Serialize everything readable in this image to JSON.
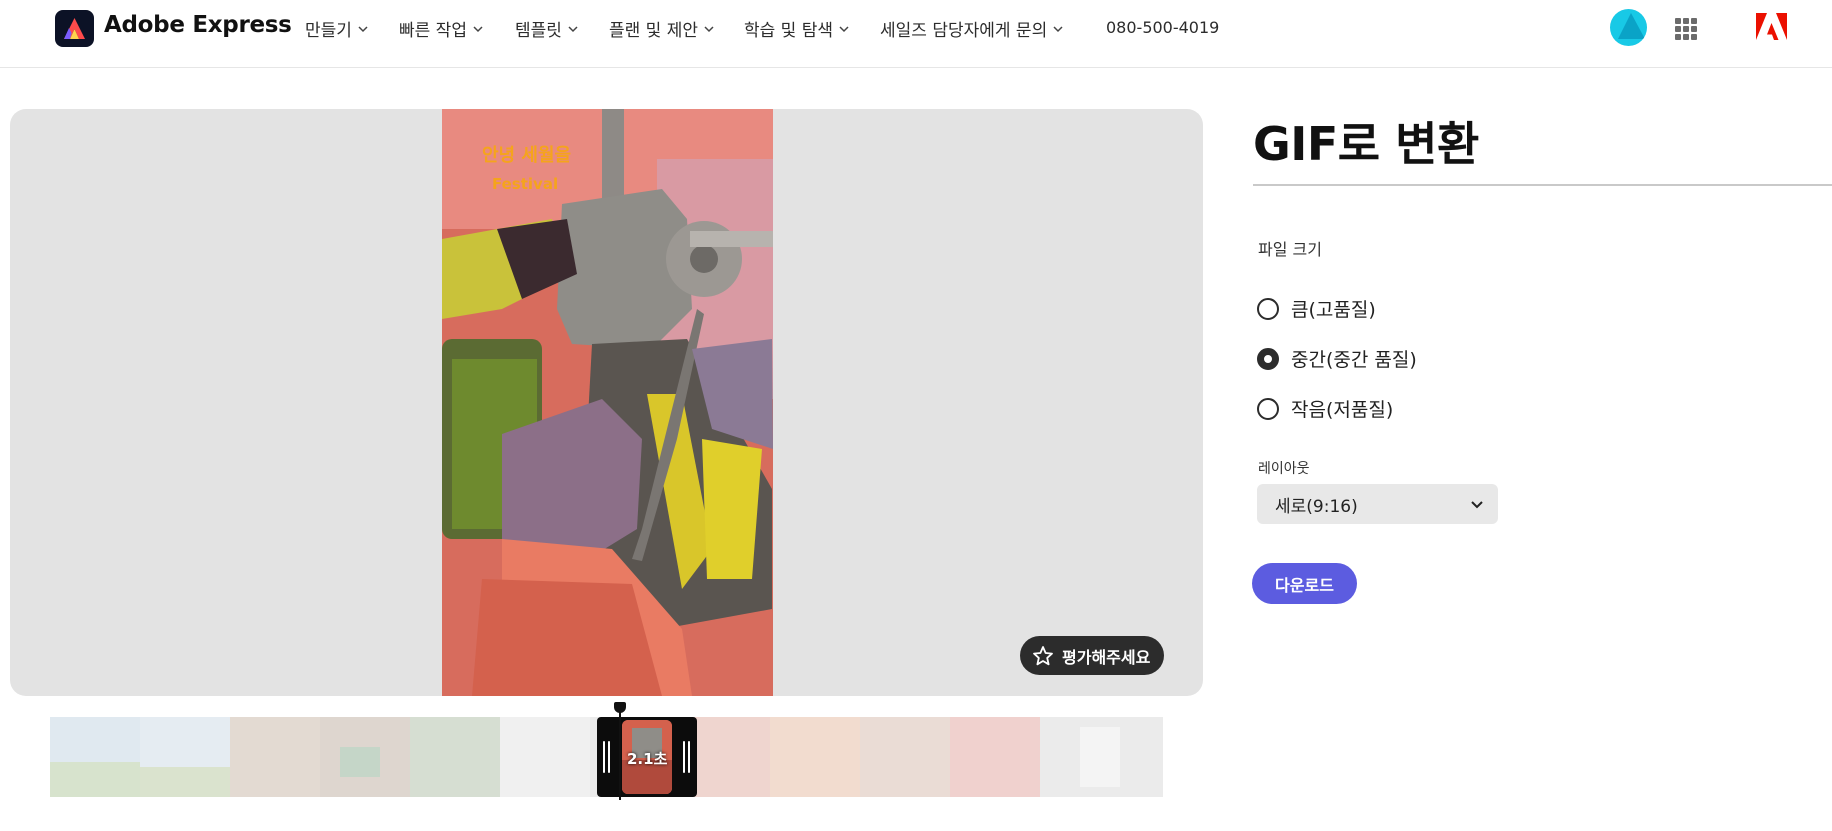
{
  "header": {
    "brand": "Adobe Express",
    "nav": [
      {
        "label": "만들기"
      },
      {
        "label": "빠른 작업"
      },
      {
        "label": "템플릿"
      },
      {
        "label": "플랜 및 제안"
      },
      {
        "label": "학습 및 탐색"
      },
      {
        "label": "세일즈 담당자에게 문의"
      }
    ],
    "phone": "080-500-4019"
  },
  "preview": {
    "rate_label": "평가해주세요",
    "video_overlay_text": [
      "안녕 세월을",
      "Festival"
    ]
  },
  "timeline": {
    "duration": "2.1초"
  },
  "panel": {
    "title": "GIF로 변환",
    "size_label": "파일 크기",
    "options": [
      {
        "label": "큼(고품질)",
        "checked": false
      },
      {
        "label": "중간(중간 품질)",
        "checked": true
      },
      {
        "label": "작음(저품질)",
        "checked": false
      }
    ],
    "layout_label": "레이아웃",
    "layout_value": "세로(9:16)",
    "download_label": "다운로드"
  },
  "colors": {
    "accent": "#5c5ce0",
    "avatar": "#18c9e6",
    "adobe_red": "#eb1000",
    "dark": "#2c2c2c"
  },
  "icons": [
    "express-logo-icon",
    "chevron-down-icon",
    "apps-grid-icon",
    "adobe-logo-icon",
    "star-icon"
  ]
}
